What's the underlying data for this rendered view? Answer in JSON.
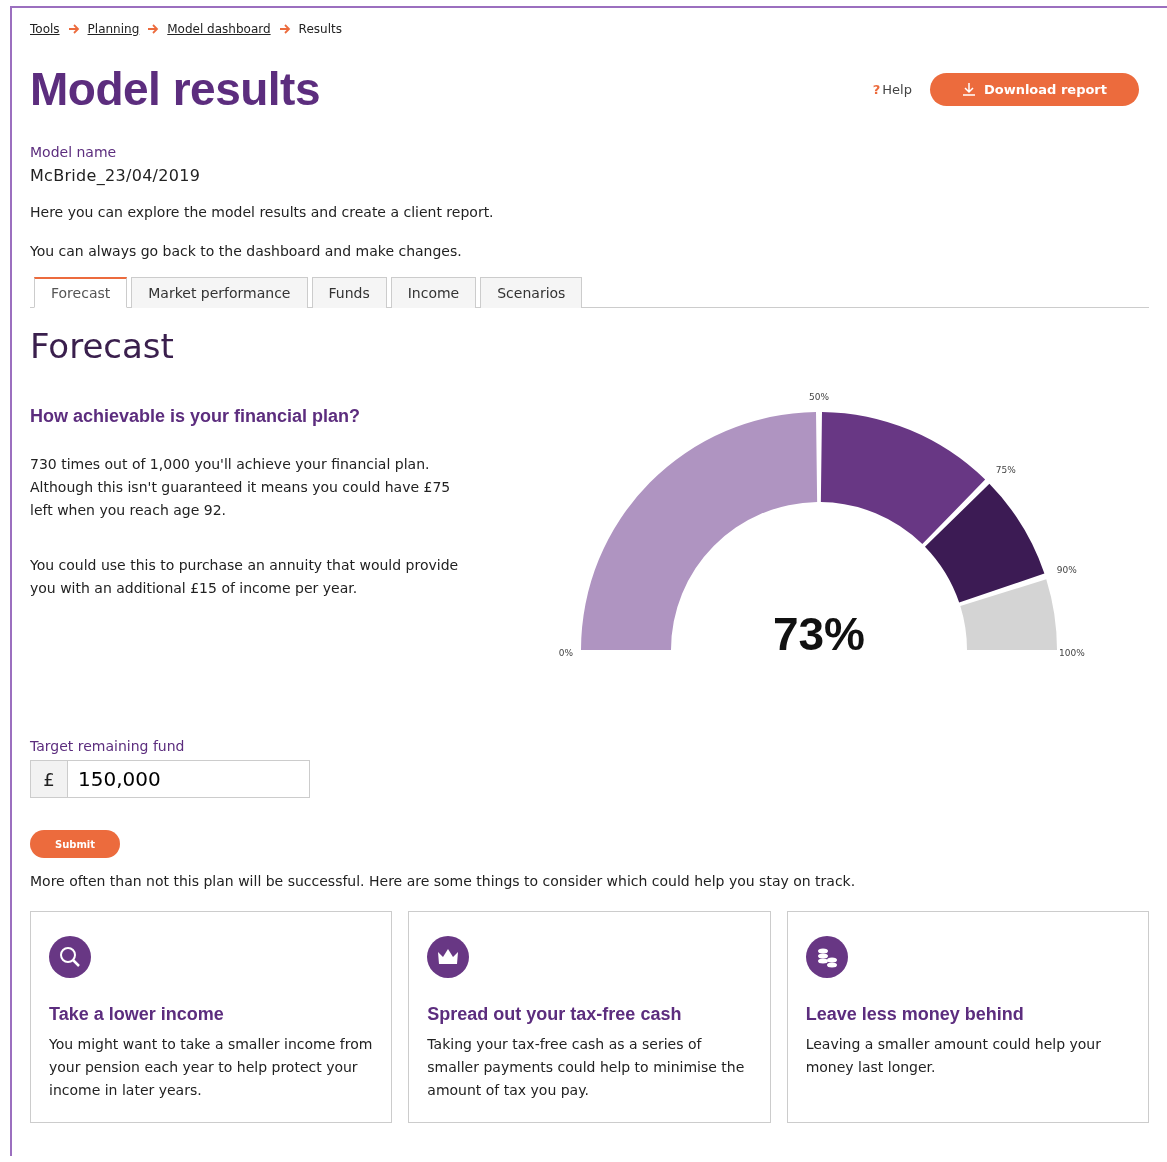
{
  "breadcrumbs": [
    {
      "label": "Tools",
      "link": true
    },
    {
      "label": "Planning",
      "link": true
    },
    {
      "label": "Model dashboard",
      "link": true
    },
    {
      "label": "Results",
      "link": false
    }
  ],
  "title": "Model results",
  "help": {
    "icon": "?",
    "label": "Help"
  },
  "download_button": "Download report",
  "model_name": {
    "label": "Model name",
    "value": "McBride_23/04/2019"
  },
  "intro": [
    "Here you can explore the model results and create a client report.",
    "You can always go back to the dashboard and make changes."
  ],
  "tabs": [
    {
      "label": "Forecast",
      "selected": true
    },
    {
      "label": "Market performance",
      "selected": false
    },
    {
      "label": "Funds",
      "selected": false
    },
    {
      "label": "Income",
      "selected": false
    },
    {
      "label": "Scenarios",
      "selected": false
    }
  ],
  "section_title": "Forecast",
  "question": "How achievable is your financial plan?",
  "paragraphs": [
    "730 times out of 1,000 you'll achieve your financial plan. Although this isn't guaranteed it means you could have £75 left when you reach age 92.",
    "You could use this to purchase an annuity that would provide you with an additional £15 of income per year."
  ],
  "gauge": {
    "reading": "73%",
    "ticks": [
      "0%",
      "50%",
      "75%",
      "90%",
      "100%"
    ],
    "bands": [
      {
        "color": "#af94c1"
      },
      {
        "color": "#683784"
      },
      {
        "color": "#3c1b54"
      },
      {
        "color": "#d4d4d4"
      }
    ]
  },
  "target": {
    "label": "Target remaining fund",
    "prefix": "£",
    "value": "150,000"
  },
  "submit": "Submit",
  "summary": "More often than not this plan will be successful. Here are some things to consider which could help you stay on track.",
  "cards": [
    {
      "kind": "search",
      "title": "Take a lower income",
      "text": "You might want to take a smaller income from your pension each year to help protect your income in later years."
    },
    {
      "kind": "crown",
      "title": "Spread out your tax-free cash",
      "text": "Taking your tax-free cash as a series of smaller payments could help to minimise the amount of tax you pay."
    },
    {
      "kind": "coins",
      "title": "Leave less money behind",
      "text": "Leaving a smaller amount could help your money last longer."
    }
  ]
}
